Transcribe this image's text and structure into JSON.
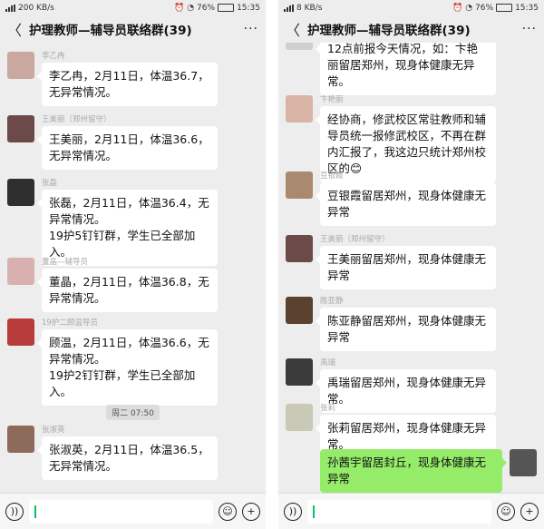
{
  "left": {
    "status": {
      "speed": "200 KB/s",
      "time": "15:35",
      "battery": "76%"
    },
    "title": "护理教师—辅导员联络群(39)",
    "messages": [
      {
        "nick": "李乙冉",
        "text": "李乙冉，2月11日，体温36.7，无异常情况。",
        "avatar_color": "#c9a8a0"
      },
      {
        "nick": "王美丽（郑州留守）",
        "text": "王美丽，2月11日，体温36.6，无异常情况。",
        "avatar_color": "#6d4a4a"
      },
      {
        "nick": "张磊",
        "text": "张磊，2月11日，体温36.4，无异常情况。\n19护5钉钉群，学生已全部加入。",
        "avatar_color": "#2f2f2f"
      },
      {
        "nick": "董晶—辅导员",
        "text": "董晶，2月11日，体温36.8，无异常情况。",
        "avatar_color": "#d9b0b0"
      },
      {
        "nick": "19护二顾温导员",
        "text": "顾温，2月11日，体温36.6，无异常情况。\n19护2钉钉群，学生已全部加入。",
        "avatar_color": "#b73b3b"
      },
      {
        "nick": "张淑英",
        "text": "张淑英，2月11日，体温36.5，无异常情况。",
        "avatar_color": "#8c6b5a"
      }
    ],
    "time_chip": "周二 07:50"
  },
  "right": {
    "status": {
      "speed": "8 KB/s",
      "time": "15:35",
      "battery": "76%"
    },
    "title": "护理教师—辅导员联络群(39)",
    "messages": [
      {
        "nick": "",
        "text": "12点前报今天情况，如：卞艳丽留居郑州，现身体健康无异常。",
        "avatar_color": "#cfcfcf"
      },
      {
        "nick": "卞艳丽",
        "text": "经协商，修武校区常驻教师和辅导员统一报修武校区，不再在群内汇报了，我这边只统计郑州校区的😊",
        "avatar_color": "#d8b4a6"
      },
      {
        "nick": "豆银霞",
        "text": "豆银霞留居郑州，现身体健康无异常",
        "avatar_color": "#a98a70"
      },
      {
        "nick": "王美丽（郑州留守）",
        "text": "王美丽留居郑州，现身体健康无异常",
        "avatar_color": "#6d4a4a"
      },
      {
        "nick": "陈亚静",
        "text": "陈亚静留居郑州，现身体健康无异常",
        "avatar_color": "#5a4130"
      },
      {
        "nick": "禹瑞",
        "text": "禹瑞留居郑州，现身体健康无异常。",
        "avatar_color": "#3b3b3b"
      },
      {
        "nick": "张莉",
        "text": "张莉留居郑州，现身体健康无异常。",
        "avatar_color": "#c9c9b8"
      },
      {
        "nick": "",
        "text": "孙茜宇留居封丘，现身体健康无异常",
        "avatar_color": "#555555"
      }
    ]
  },
  "colors": {
    "bg": "#ededed",
    "bubble_other": "#ffffff",
    "bubble_me": "#95ec69",
    "input_accent": "#07c160"
  },
  "icons": [
    "back-arrow-icon",
    "more-dots-icon",
    "voice-icon",
    "emoji-icon",
    "plus-icon"
  ]
}
